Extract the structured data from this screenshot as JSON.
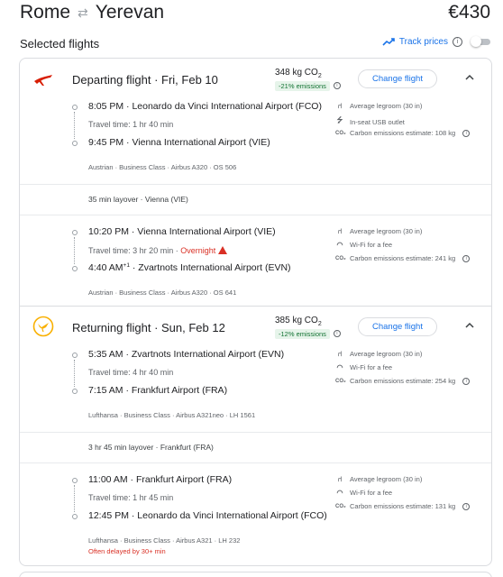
{
  "header": {
    "origin": "Rome",
    "destination": "Yerevan",
    "swap_icon": "⇄",
    "price": "€430"
  },
  "selected_label": "Selected flights",
  "track_prices": {
    "label": "Track prices",
    "enabled": false
  },
  "departing": {
    "title": "Departing flight",
    "date": "Fri, Feb 10",
    "co2": "348 kg CO",
    "co2_sub": "2",
    "emissions": "-21% emissions",
    "change_label": "Change flight",
    "segments": [
      {
        "dep_time": "8:05 PM",
        "dep_airport": "Leonardo da Vinci International Airport (FCO)",
        "travel_time": "Travel time: 1 hr 40 min",
        "overnight": "",
        "arr_time": "9:45 PM",
        "arr_plus": "",
        "arr_airport": "Vienna International Airport (VIE)",
        "meta": "Austrian · Business Class · Airbus A320 · OS 506",
        "delay": "",
        "amenities": [
          {
            "icon": "legroom-icon",
            "text": "Average legroom (30 in)"
          },
          {
            "icon": "usb-icon",
            "text": "In-seat USB outlet"
          },
          {
            "icon": "co2-icon",
            "text": "Carbon emissions estimate: 108 kg"
          }
        ]
      },
      {
        "dep_time": "10:20 PM",
        "dep_airport": "Vienna International Airport (VIE)",
        "travel_time": "Travel time: 3 hr 20 min",
        "overnight": "Overnight",
        "arr_time": "4:40 AM",
        "arr_plus": "+1",
        "arr_airport": "Zvartnots International Airport (EVN)",
        "meta": "Austrian · Business Class · Airbus A320 · OS 641",
        "delay": "",
        "amenities": [
          {
            "icon": "legroom-icon",
            "text": "Average legroom (30 in)"
          },
          {
            "icon": "wifi-icon",
            "text": "Wi-Fi for a fee"
          },
          {
            "icon": "co2-icon",
            "text": "Carbon emissions estimate: 241 kg"
          }
        ]
      }
    ],
    "layover": "35 min layover · Vienna (VIE)"
  },
  "returning": {
    "title": "Returning flight",
    "date": "Sun, Feb 12",
    "co2": "385 kg CO",
    "co2_sub": "2",
    "emissions": "-12% emissions",
    "change_label": "Change flight",
    "segments": [
      {
        "dep_time": "5:35 AM",
        "dep_airport": "Zvartnots International Airport (EVN)",
        "travel_time": "Travel time: 4 hr 40 min",
        "overnight": "",
        "arr_time": "7:15 AM",
        "arr_plus": "",
        "arr_airport": "Frankfurt Airport (FRA)",
        "meta": "Lufthansa · Business Class · Airbus A321neo · LH 1561",
        "delay": "",
        "amenities": [
          {
            "icon": "legroom-icon",
            "text": "Average legroom (30 in)"
          },
          {
            "icon": "wifi-icon",
            "text": "Wi-Fi for a fee"
          },
          {
            "icon": "co2-icon",
            "text": "Carbon emissions estimate: 254 kg"
          }
        ]
      },
      {
        "dep_time": "11:00 AM",
        "dep_airport": "Frankfurt Airport (FRA)",
        "travel_time": "Travel time: 1 hr 45 min",
        "overnight": "",
        "arr_time": "12:45 PM",
        "arr_plus": "",
        "arr_airport": "Leonardo da Vinci International Airport (FCO)",
        "meta": "Lufthansa · Business Class · Airbus A321 · LH 232",
        "delay": "Often delayed by 30+ min",
        "amenities": [
          {
            "icon": "legroom-icon",
            "text": "Average legroom (30 in)"
          },
          {
            "icon": "wifi-icon",
            "text": "Wi-Fi for a fee"
          },
          {
            "icon": "co2-icon",
            "text": "Carbon emissions estimate: 131 kg"
          }
        ]
      }
    ],
    "layover": "3 hr 45 min layover · Frankfurt (FRA)"
  },
  "colors": {
    "accent": "#1a73e8",
    "green_bg": "#e6f4ea",
    "green_text": "#137333",
    "warning": "#d93025"
  }
}
